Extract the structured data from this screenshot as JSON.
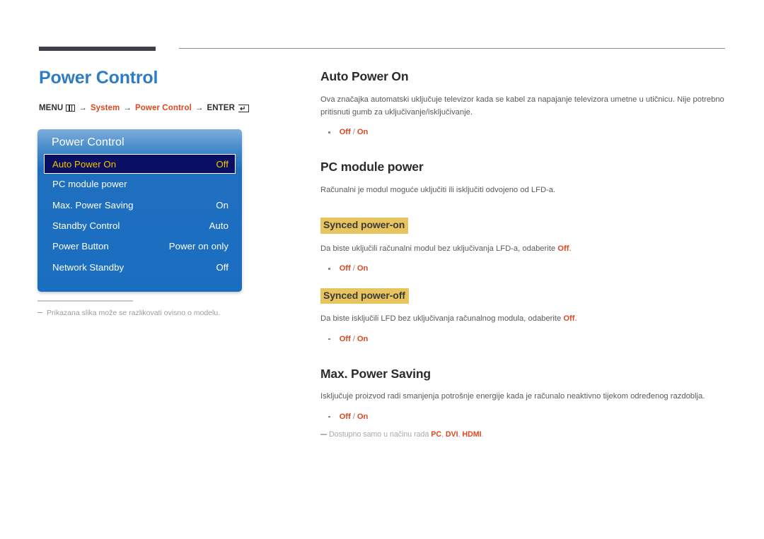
{
  "page": {
    "title": "Power Control",
    "title_color": "#2e7cc4"
  },
  "breadcrumb": {
    "menu_label": "MENU",
    "menu_icon": "menu-grid-icon",
    "arrow": "→",
    "step1": "System",
    "step2": "Power Control",
    "enter_label": "ENTER",
    "enter_icon": "enter-return-icon",
    "accent_color": "#e0481f"
  },
  "osd": {
    "title": "Power Control",
    "rows": [
      {
        "label": "Auto Power On",
        "value": "Off",
        "selected": true
      },
      {
        "label": "PC module power",
        "value": "",
        "selected": false
      },
      {
        "label": "Max. Power Saving",
        "value": "On",
        "selected": false
      },
      {
        "label": "Standby Control",
        "value": "Auto",
        "selected": false
      },
      {
        "label": "Power Button",
        "value": "Power on only",
        "selected": false
      },
      {
        "label": "Network Standby",
        "value": "Off",
        "selected": false
      }
    ],
    "panel_color": "#1a6ec0",
    "selected_bg": "#0a0f63",
    "selected_text": "#f2c500"
  },
  "left_note": {
    "text": "Prikazana slika može se razlikovati ovisno o modelu."
  },
  "sections": {
    "auto_power_on": {
      "heading": "Auto Power On",
      "body_prefix": "Ova značajka automatski uključuje televizor kada se kabel za napajanje televizora umetne u utičnicu. Nije potrebno pritisnuti gumb za uključivanje/isključivanje.",
      "option_off": "Off",
      "option_sep": "/",
      "option_on": "On"
    },
    "pc_module_power": {
      "heading": "PC module power",
      "body": "Računalni je modul moguće uključiti ili isključiti odvojeno od LFD-a.",
      "sub_on": {
        "label": "Synced power-on",
        "body_prefix": "Da biste uključili računalni modul bez uključivanja LFD-a, odaberite ",
        "body_highlight": "Off",
        "body_suffix": ".",
        "option_off": "Off",
        "option_sep": "/",
        "option_on": "On"
      },
      "sub_off": {
        "label": "Synced power-off",
        "body_prefix": "Da biste isključili LFD bez uključivanja računalnog modula, odaberite ",
        "body_highlight": "Off",
        "body_suffix": ".",
        "option_off": "Off",
        "option_sep": "/",
        "option_on": "On"
      },
      "highlight_color": "#e8c45e"
    },
    "max_power_saving": {
      "heading": "Max. Power Saving",
      "body": "Isključuje proizvod radi smanjenja potrošnje energije kada je računalo neaktivno tijekom određenog razdoblja.",
      "option_off": "Off",
      "option_sep": "/",
      "option_on": "On",
      "note_prefix": "Dostupno samo u načinu rada ",
      "note_pc": "PC",
      "note_comma1": ", ",
      "note_dvi": "DVI",
      "note_comma2": ", ",
      "note_hdmi": "HDMI",
      "note_suffix": "."
    }
  }
}
